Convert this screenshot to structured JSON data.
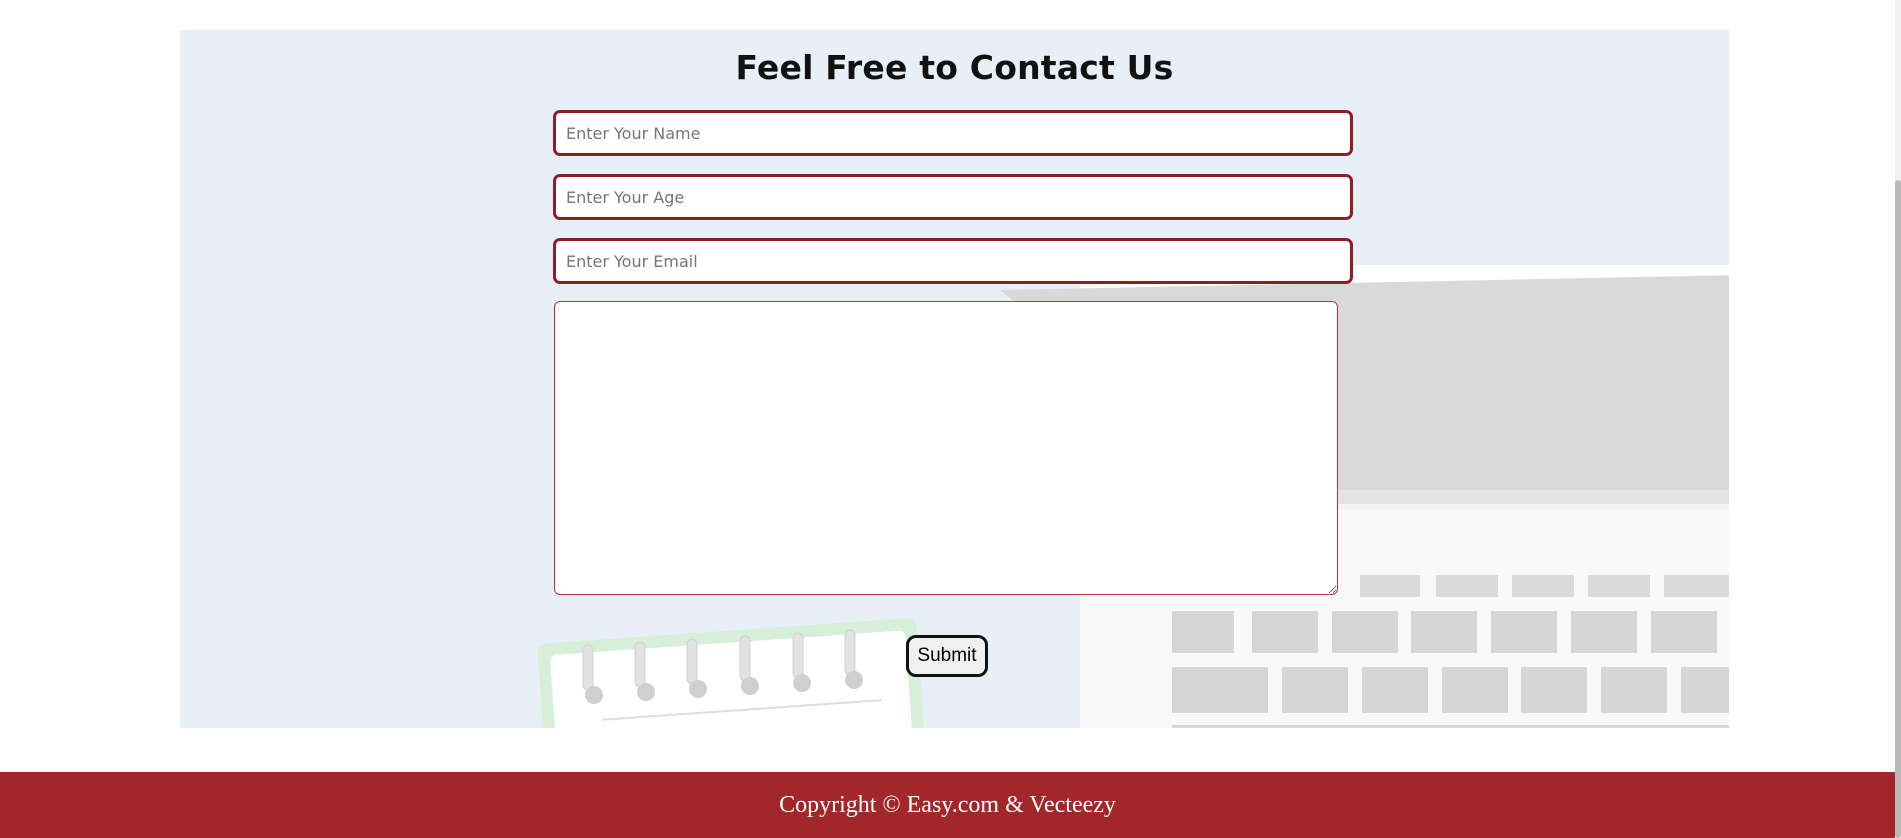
{
  "contact": {
    "title": "Feel Free to Contact Us",
    "name_placeholder": "Enter Your Name",
    "age_placeholder": "Enter Your Age",
    "email_placeholder": "Enter Your Email",
    "message_value": "",
    "submit_label": "Submit"
  },
  "footer": {
    "copyright": "Copyright © Easy.com & Vecteezy"
  },
  "colors": {
    "section_background": "#e8eff6",
    "field_border": "#8c1f24",
    "footer_background": "#a3262a"
  },
  "icons": {
    "background_illustration": "laptop-and-notebook-illustration",
    "resize_handle": "resize-grip-icon"
  }
}
